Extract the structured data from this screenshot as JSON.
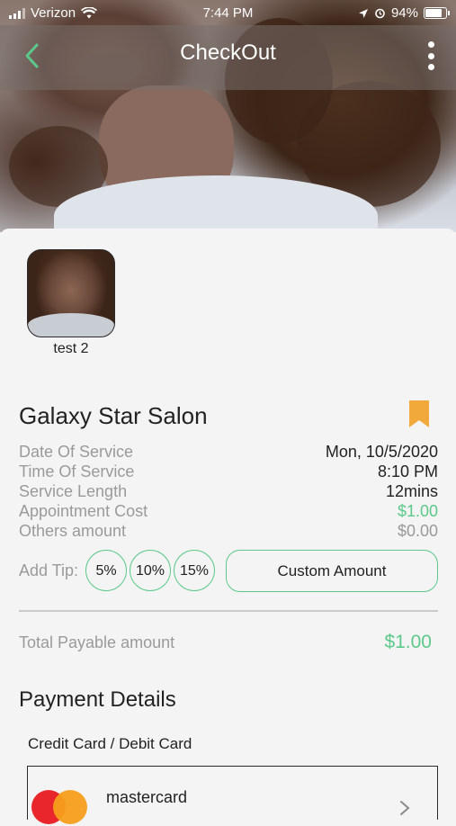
{
  "status_bar": {
    "carrier": "Verizon",
    "time": "7:44 PM",
    "battery": "94%",
    "battery_level": 0.94
  },
  "nav": {
    "title": "CheckOut",
    "back_icon": "chevron-left-icon",
    "more_icon": "more-vertical-icon"
  },
  "stylist": {
    "name": "test 2"
  },
  "salon": {
    "name": "Galaxy Star Salon",
    "bookmark_color": "#f2a93b"
  },
  "details": [
    {
      "label": "Date Of Service",
      "value": "Mon, 10/5/2020",
      "style": "dark"
    },
    {
      "label": "Time Of Service",
      "value": "8:10 PM",
      "style": "dark"
    },
    {
      "label": "Service Length",
      "value": "12mins",
      "style": "dark"
    },
    {
      "label": "Appointment Cost",
      "value": "$1.00",
      "style": "green"
    },
    {
      "label": "Others amount",
      "value": "$0.00",
      "style": "grey"
    }
  ],
  "tip": {
    "label": "Add Tip:",
    "options": [
      "5%",
      "10%",
      "15%"
    ],
    "custom": "Custom Amount"
  },
  "total": {
    "label": "Total Payable amount",
    "value": "$1.00"
  },
  "payment": {
    "title": "Payment Details",
    "card_type": "Credit Card / Debit Card",
    "card_name": "mastercard"
  },
  "colors": {
    "accent": "#5cc98a",
    "bookmark": "#f2a93b",
    "mastercard_red": "#e8262b",
    "mastercard_orange": "#f79e1b"
  }
}
